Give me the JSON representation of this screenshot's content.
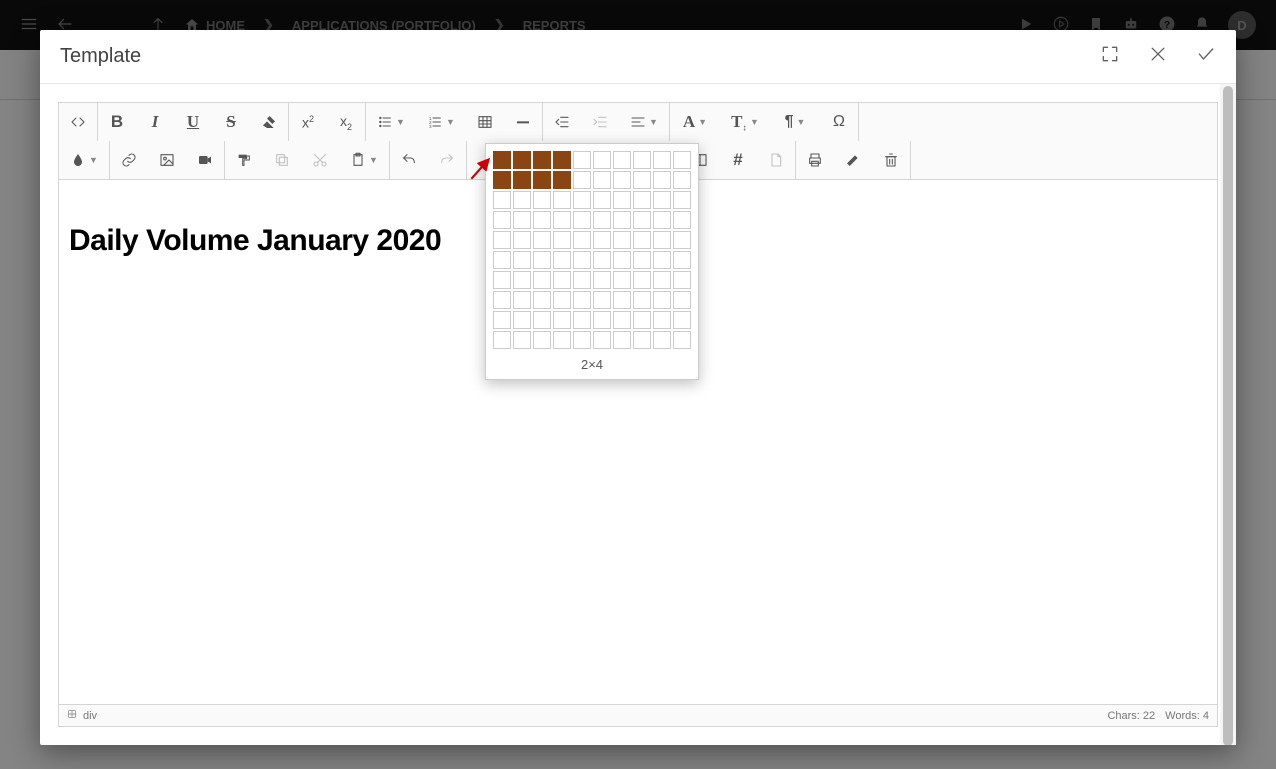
{
  "breadcrumbs": {
    "home": "HOME",
    "applications": "APPLICATIONS (PORTFOLIO)",
    "reports": "REPORTS"
  },
  "modal": {
    "title": "Template"
  },
  "editor": {
    "heading": "Daily Volume January 2020",
    "path_element": "div",
    "table_picker": {
      "rows": 2,
      "cols": 4,
      "label": "2×4"
    },
    "status": {
      "chars_label": "Chars:",
      "chars_value": "22",
      "words_label": "Words:",
      "words_value": "4"
    }
  }
}
